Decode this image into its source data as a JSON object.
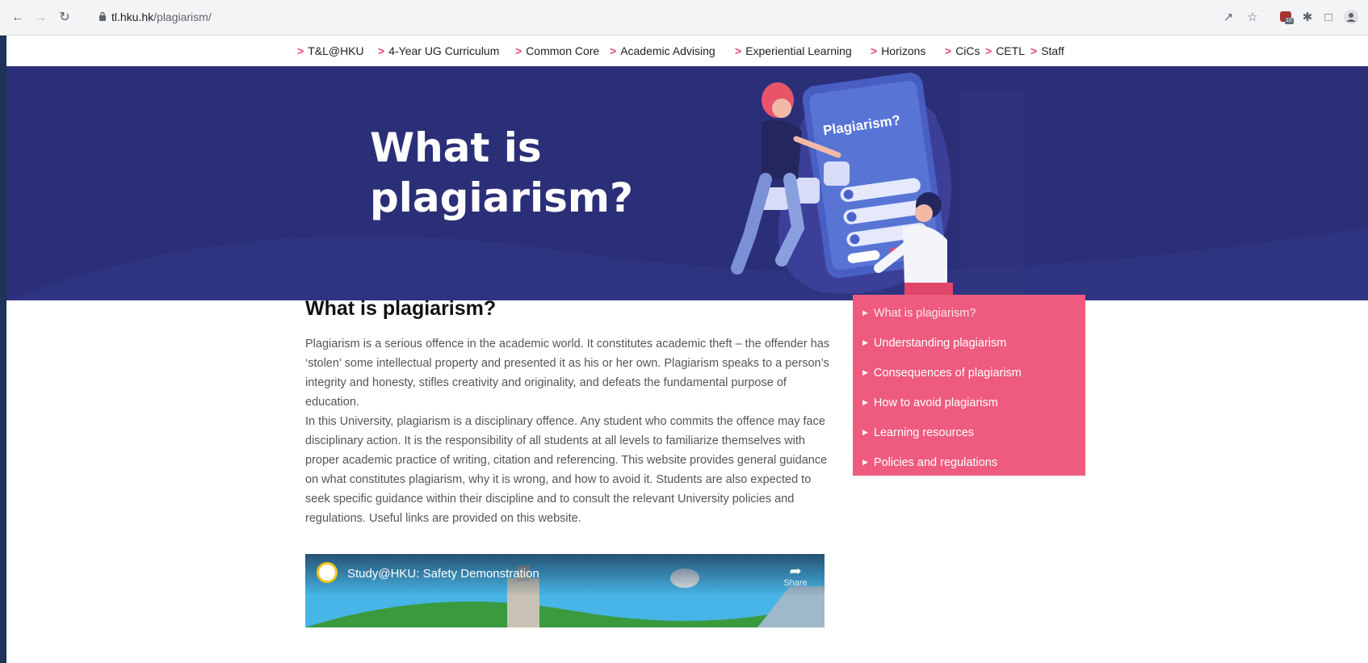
{
  "browser": {
    "url_host": "tl.hku.hk",
    "url_path": "/plagiarism/",
    "extension_badge": "10"
  },
  "topnav": [
    {
      "label": "T&L@HKU"
    },
    {
      "label": "4-Year UG Curriculum"
    },
    {
      "label": "Common Core"
    },
    {
      "label": "Academic Advising"
    },
    {
      "label": "Experiential Learning"
    },
    {
      "label": "Horizons"
    },
    {
      "label": "CiCs"
    },
    {
      "label": "CETL"
    },
    {
      "label": "Staff"
    }
  ],
  "hero": {
    "title": "What is plagiarism?",
    "illustration_text": "Plagiarism?"
  },
  "content": {
    "heading": "What is plagiarism?",
    "paragraph1": "Plagiarism is a serious offence in the academic world. It constitutes academic theft – the offender has ‘stolen’ some intellectual property and presented it as his or her own. Plagiarism speaks to a person’s integrity and honesty, stifles creativity and originality, and defeats the fundamental purpose of education.",
    "paragraph2": "In this University, plagiarism is a disciplinary offence. Any student who commits the offence may face disciplinary action. It is the responsibility of all students at all levels to familiarize themselves with proper academic practice of writing, citation and referencing. This website provides general guidance on what constitutes plagiarism, why it is wrong, and how to avoid it. Students are also expected to seek specific guidance within their discipline and to consult the relevant University policies and regulations. Useful links are provided on this website."
  },
  "side_menu": [
    {
      "label": "What is plagiarism?"
    },
    {
      "label": "Understanding plagiarism"
    },
    {
      "label": "Consequences of plagiarism"
    },
    {
      "label": "How to avoid plagiarism"
    },
    {
      "label": "Learning resources"
    },
    {
      "label": "Policies and regulations"
    }
  ],
  "video": {
    "title": "Study@HKU: Safety Demonstration",
    "share_label": "Share"
  },
  "colors": {
    "hero_bg": "#2b2f78",
    "accent_pink": "#ee5b7e",
    "nav_arrow": "#e8456a"
  }
}
